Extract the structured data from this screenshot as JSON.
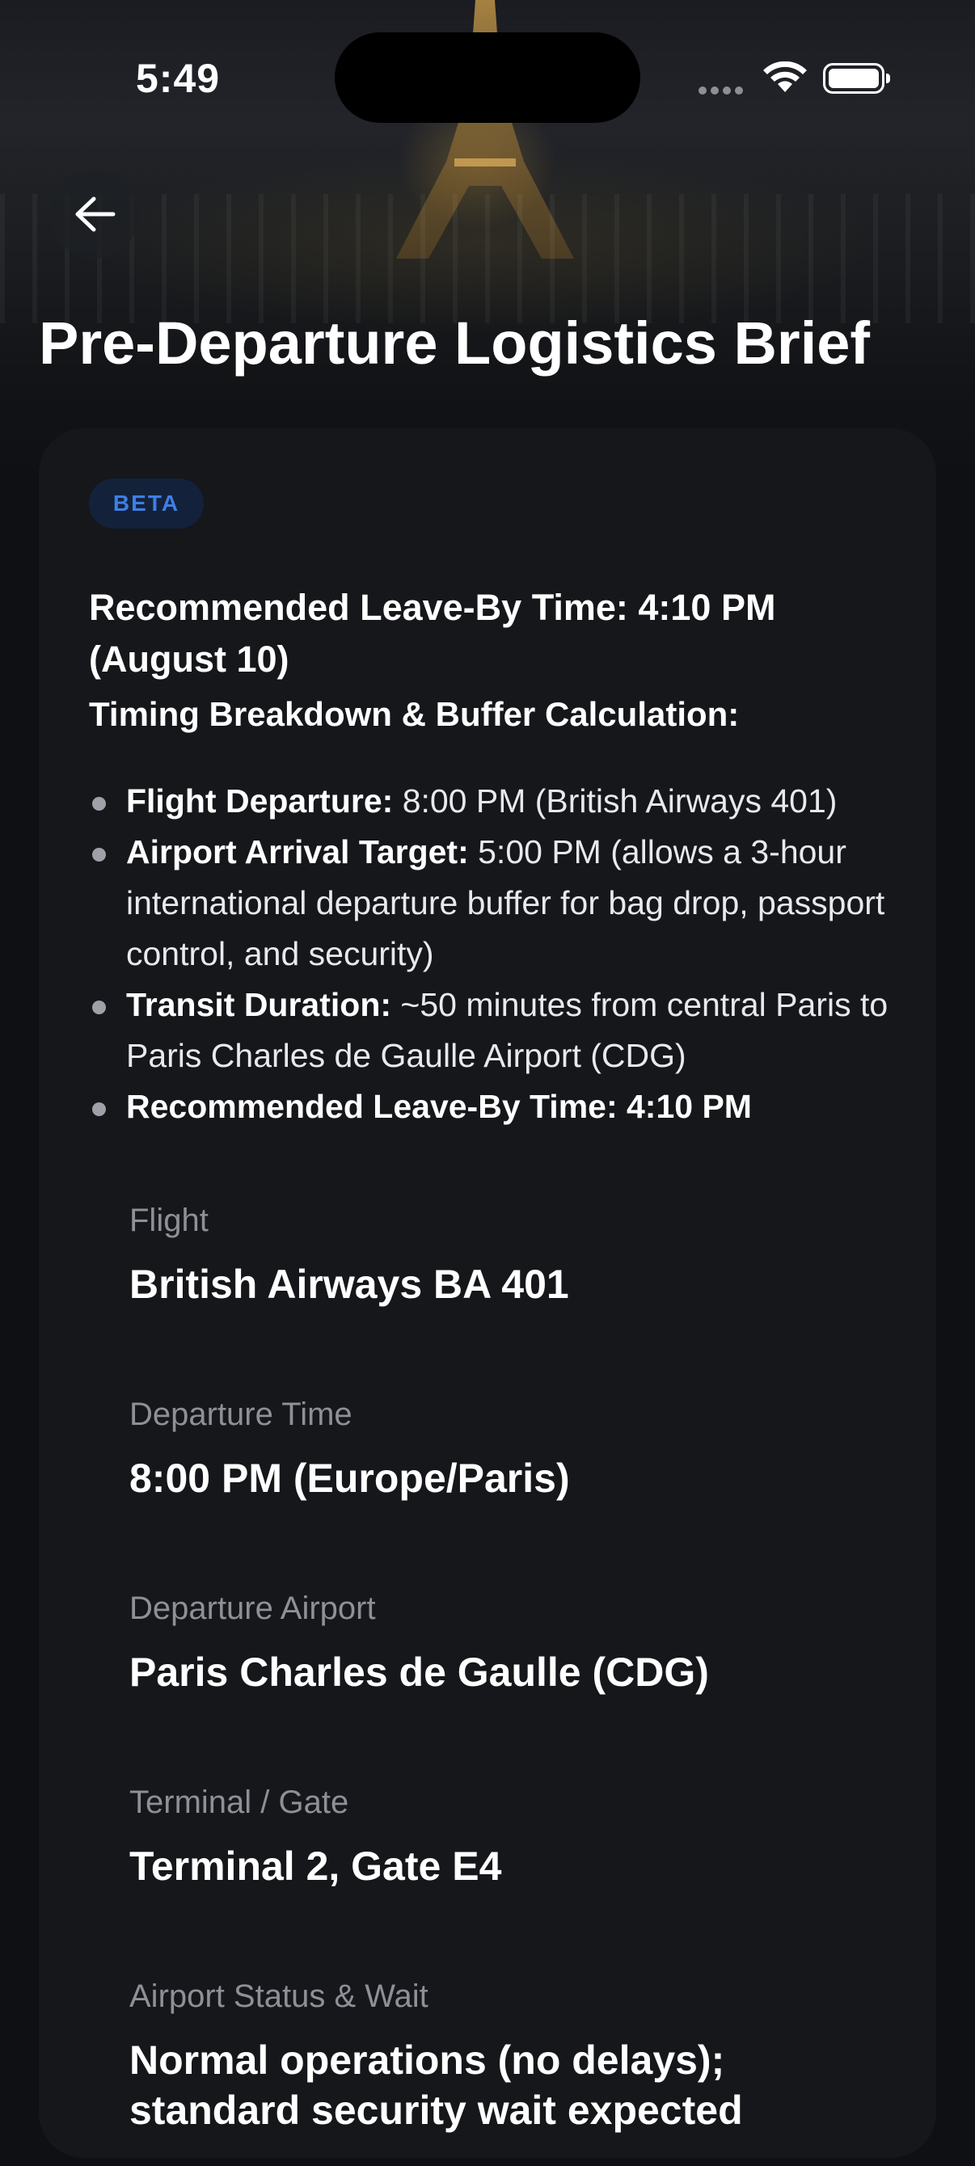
{
  "status_bar": {
    "time": "5:49"
  },
  "header": {
    "title": "Pre-Departure Logistics Brief"
  },
  "badge": "BETA",
  "recommendation": {
    "title": "Recommended Leave-By Time: 4:10 PM (August 10)",
    "breakdown_title": "Timing Breakdown & Buffer Calculation:"
  },
  "bullets": [
    {
      "label": "Flight Departure:",
      "text": " 8:00 PM (British Airways 401)"
    },
    {
      "label": "Airport Arrival Target:",
      "text": " 5:00 PM (allows a 3-hour international departure buffer for bag drop, passport control, and security)"
    },
    {
      "label": "Transit Duration:",
      "text": " ~50 minutes from central Paris to Paris Charles de Gaulle Airport (CDG)"
    },
    {
      "label": "Recommended Leave-By Time: 4:10 PM",
      "text": ""
    }
  ],
  "details": [
    {
      "label": "Flight",
      "value": "British Airways BA 401"
    },
    {
      "label": "Departure Time",
      "value": "8:00 PM (Europe/Paris)"
    },
    {
      "label": "Departure Airport",
      "value": "Paris Charles de Gaulle (CDG)"
    },
    {
      "label": "Terminal / Gate",
      "value": "Terminal 2, Gate E4"
    },
    {
      "label": "Airport Status & Wait",
      "value": "Normal operations (no delays); standard security wait expected"
    }
  ],
  "colors": {
    "background": "#0f1013",
    "card": "#16171b",
    "badge_text": "#3f7ee8",
    "badge_bg": "#13223a",
    "muted": "#8e9097"
  },
  "icons": {
    "back": "arrow-left-icon",
    "wifi": "wifi-icon",
    "battery": "battery-icon",
    "signal": "signal-dots-icon"
  }
}
